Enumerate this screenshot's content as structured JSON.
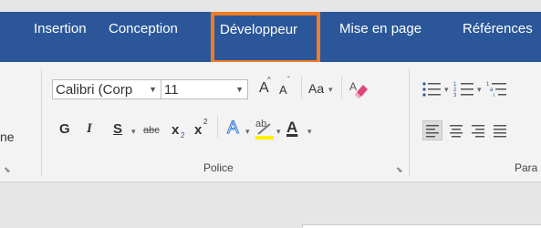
{
  "tabs": [
    {
      "label": "Insertion"
    },
    {
      "label": "Conception"
    },
    {
      "label": "Développeur"
    },
    {
      "label": "Mise en page"
    },
    {
      "label": "Références"
    }
  ],
  "ribbon": {
    "partial_left_label": "ne",
    "font_name": "Calibri (Corp",
    "font_size": "11",
    "glyphs": {
      "grow_font": "A",
      "shrink_font": "A",
      "change_case": "Aa",
      "bold": "G",
      "italic": "I",
      "underline": "S",
      "strikethrough": "abc",
      "subscript_base": "x",
      "subscript_mark": "2",
      "superscript_base": "x",
      "superscript_mark": "2",
      "text_effects": "A",
      "highlight": "ab",
      "font_color": "A"
    },
    "groups": {
      "police": "Police",
      "paragraph_partial": "Para"
    }
  },
  "colors": {
    "tab_bar": "#2b579a",
    "highlight_box": "#ef7d22",
    "font_color_underline": "#000000",
    "highlight_color": "#ffef00"
  }
}
